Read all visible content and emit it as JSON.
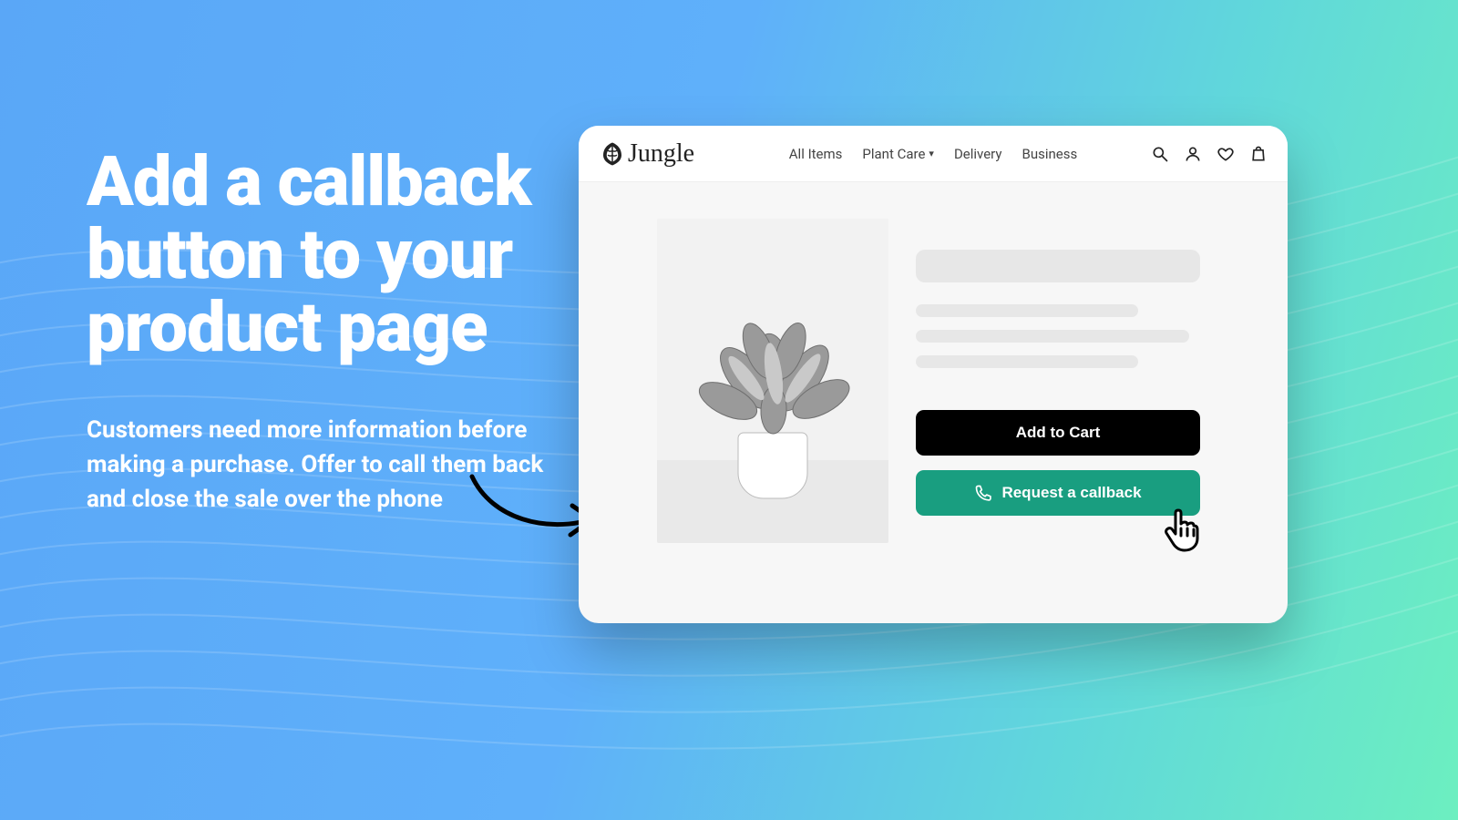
{
  "marketing": {
    "headline": "Add a callback button to your product page",
    "subcopy": "Customers need more information before making a purchase. Offer to call them back and close the sale over the phone"
  },
  "mock_store": {
    "brand_name": "Jungle",
    "nav": {
      "all_items": "All Items",
      "plant_care": "Plant Care",
      "delivery": "Delivery",
      "business": "Business"
    },
    "buttons": {
      "add_to_cart": "Add to Cart",
      "request_callback": "Request a callback"
    }
  },
  "colors": {
    "callback_button": "#199e80",
    "cart_button": "#000000"
  }
}
